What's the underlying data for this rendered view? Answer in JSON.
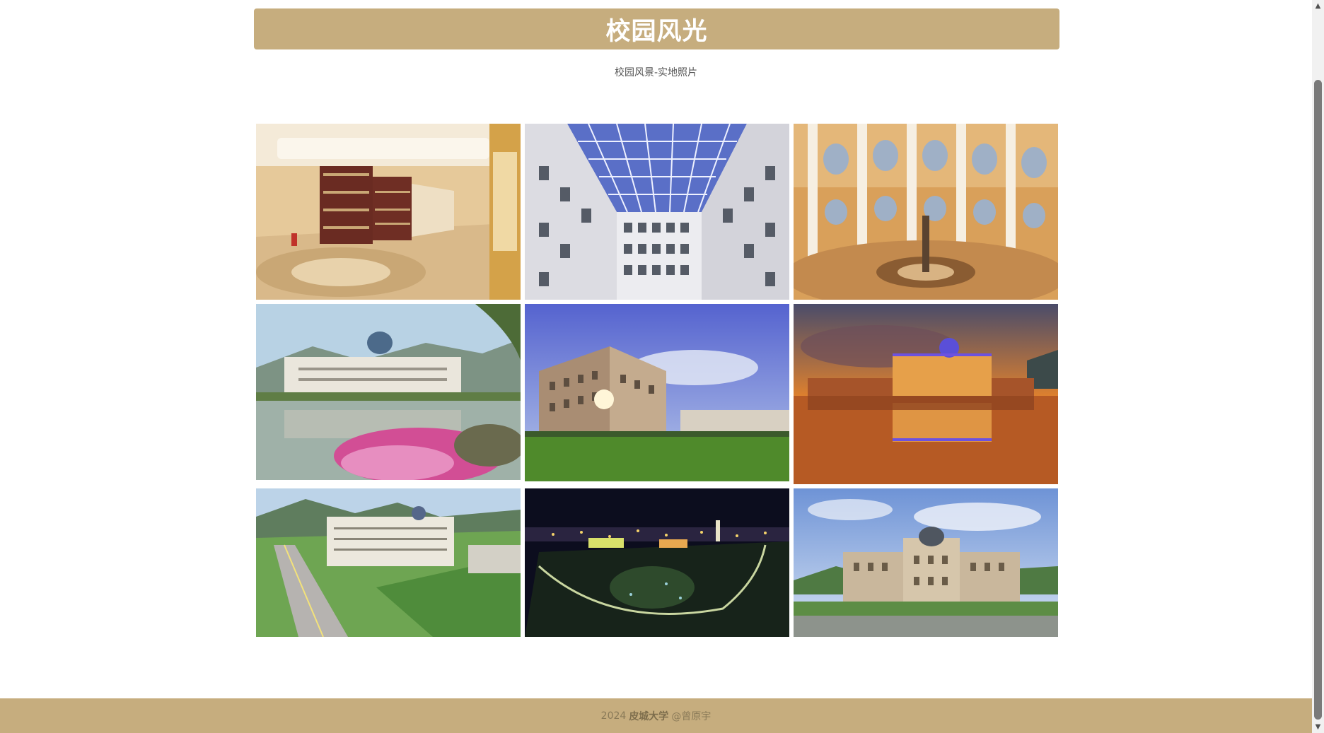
{
  "header": {
    "title": "校园风光"
  },
  "subtitle": "校园风景-实地照片",
  "gallery": {
    "photos": [
      {
        "name": "library-hall-photo"
      },
      {
        "name": "glass-atrium-photo"
      },
      {
        "name": "rotunda-interior-photo"
      },
      {
        "name": "lakeside-campus-photo"
      },
      {
        "name": "lawn-sunburst-photo"
      },
      {
        "name": "sunset-reflection-photo"
      },
      {
        "name": "aerial-road-photo"
      },
      {
        "name": "night-aerial-photo"
      },
      {
        "name": "dome-building-photo"
      }
    ]
  },
  "footer": {
    "year": "2024",
    "university": "皮城大学",
    "author": "@曾原宇"
  }
}
